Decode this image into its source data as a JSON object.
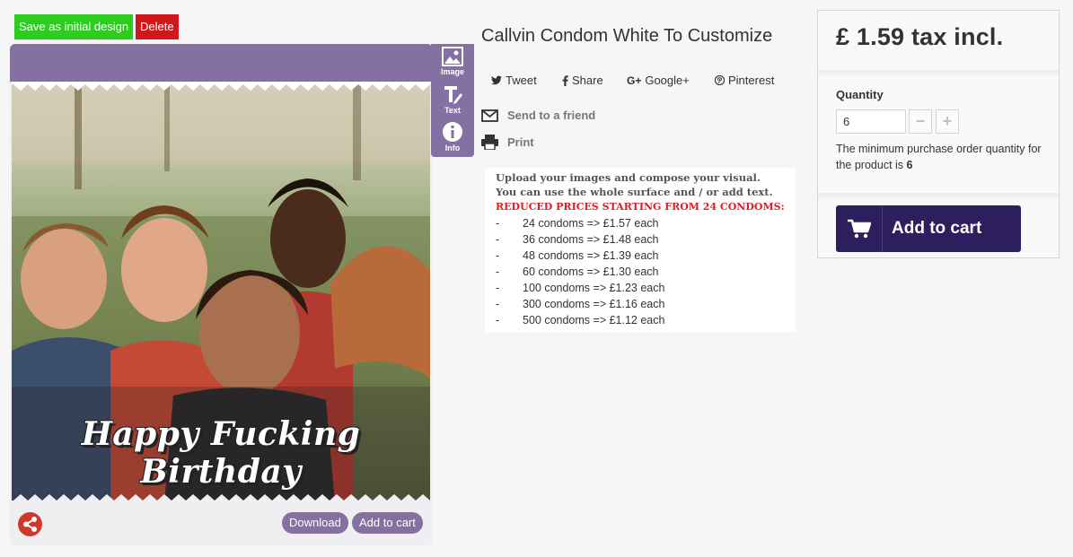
{
  "designer": {
    "save_label": "Save as initial design",
    "delete_label": "Delete",
    "tools": [
      {
        "label": "Image",
        "icon": "image-icon"
      },
      {
        "label": "Text",
        "icon": "text-icon"
      },
      {
        "label": "Info",
        "icon": "info-icon"
      }
    ],
    "caption": "Happy Fucking Birthday",
    "download_label": "Download",
    "add_to_cart_label": "Add to cart",
    "accent_color": "#8570a3"
  },
  "product": {
    "title": "Callvin Condom White To Customize",
    "social": [
      {
        "label": "Tweet",
        "icon": "twitter-icon"
      },
      {
        "label": "Share",
        "icon": "facebook-icon"
      },
      {
        "label": "Google+",
        "icon": "google-plus-icon"
      },
      {
        "label": "Pinterest",
        "icon": "pinterest-icon"
      }
    ],
    "send_to_friend": "Send to a friend",
    "print": "Print",
    "description": {
      "line1": "Upload your images and compose your visual.",
      "line2": "You can use the whole surface and / or add text.",
      "reduced_heading": "REDUCED PRICES STARTING FROM 24 CONDOMS:",
      "tiers": [
        {
          "dash": "-",
          "text": "24 condoms => £1.57 each"
        },
        {
          "dash": "-",
          "text": "36 condoms => £1.48 each"
        },
        {
          "dash": "-",
          "text": "48 condoms => £1.39 each"
        },
        {
          "dash": "-",
          "text": "60 condoms => £1.30 each"
        },
        {
          "dash": "-",
          "text": "100 condoms => £1.23 each"
        },
        {
          "dash": "-",
          "text": "300 condoms => £1.16 each"
        },
        {
          "dash": "-",
          "text": "500 condoms => £1.12 each"
        }
      ]
    }
  },
  "buybox": {
    "price": "£ 1.59 tax incl.",
    "quantity_label": "Quantity",
    "quantity_value": "6",
    "minus": "−",
    "plus": "+",
    "min_note_prefix": "The minimum purchase order quantity for the product is",
    "min_qty": "6",
    "add_to_cart_label": "Add to cart",
    "button_color": "#2d1e5e"
  }
}
